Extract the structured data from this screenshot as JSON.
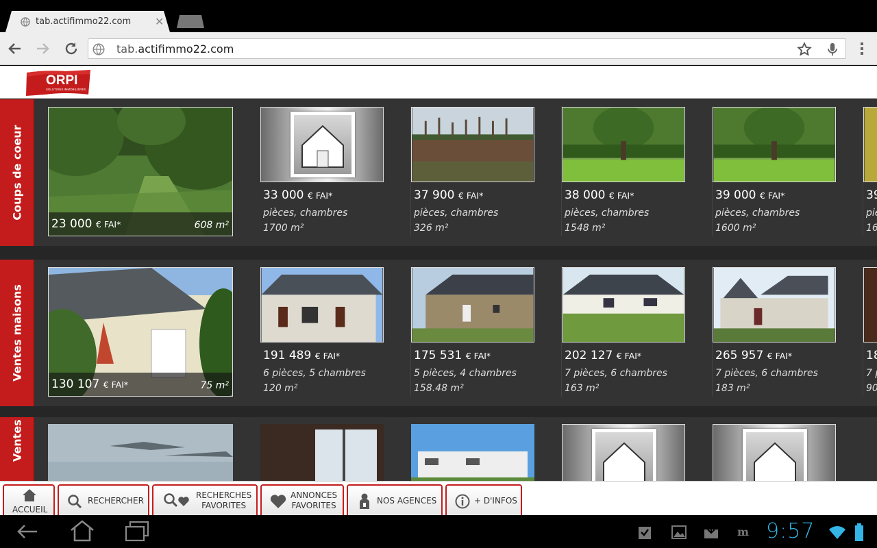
{
  "browser": {
    "tab_title": "tab.actifimmo22.com",
    "url_prefix": "tab.",
    "url_domain": "actifimmo22.com",
    "icons": [
      "globe-icon",
      "close-icon",
      "back-icon",
      "forward-icon",
      "reload-icon",
      "star-icon",
      "mic-icon",
      "menu-icon"
    ]
  },
  "header": {
    "logo_text": "ORPI",
    "logo_sub": "SOLUTIONS IMMOBILIÈRES",
    "brand_color": "#c41c1c"
  },
  "sections": [
    {
      "label": "Coups de coeur",
      "featured": {
        "price": "23 000",
        "suffix": "€ FAI*",
        "area": "608 m²"
      },
      "cards": [
        {
          "price": "33 000",
          "suffix": "€ FAI*",
          "rooms": "pièces, chambres",
          "area": "1700 m²"
        },
        {
          "price": "37 900",
          "suffix": "€ FAI*",
          "rooms": "pièces, chambres",
          "area": "326 m²"
        },
        {
          "price": "38 000",
          "suffix": "€ FAI*",
          "rooms": "pièces, chambres",
          "area": "1548 m²"
        },
        {
          "price": "39 000",
          "suffix": "€ FAI*",
          "rooms": "pièces, chambres",
          "area": "1600 m²"
        },
        {
          "price": "39",
          "suffix": "",
          "rooms": "piè",
          "area": "16"
        }
      ]
    },
    {
      "label": "Ventes maisons",
      "featured": {
        "price": "130 107",
        "suffix": "€ FAI*",
        "area": "75 m²"
      },
      "cards": [
        {
          "price": "191 489",
          "suffix": "€ FAI*",
          "rooms": "6 pièces, 5 chambres",
          "area": "120 m²"
        },
        {
          "price": "175 531",
          "suffix": "€ FAI*",
          "rooms": "5 pièces, 4 chambres",
          "area": "158.48 m²"
        },
        {
          "price": "202 127",
          "suffix": "€ FAI*",
          "rooms": "7 pièces, 6 chambres",
          "area": "163 m²"
        },
        {
          "price": "265 957",
          "suffix": "€ FAI*",
          "rooms": "7 pièces, 6 chambres",
          "area": "183 m²"
        },
        {
          "price": "18",
          "suffix": "",
          "rooms": "7 p",
          "area": "90"
        }
      ]
    },
    {
      "label": "Ventes appartements"
    }
  ],
  "bottom_nav": [
    {
      "line1": "ACCUEIL",
      "line2": "",
      "icon": "home-icon"
    },
    {
      "line1": "RECHERCHER",
      "line2": "",
      "icon": "search-icon"
    },
    {
      "line1": "RECHERCHES",
      "line2": "FAVORITES",
      "icon": "search-heart-icon"
    },
    {
      "line1": "ANNONCES",
      "line2": "FAVORITES",
      "icon": "heart-icon"
    },
    {
      "line1": "NOS AGENCES",
      "line2": "",
      "icon": "person-pin-icon"
    },
    {
      "line1": "+ D'INFOS",
      "line2": "",
      "icon": "info-icon"
    }
  ],
  "system": {
    "clock": "9:57",
    "accent": "#33b5e5"
  }
}
